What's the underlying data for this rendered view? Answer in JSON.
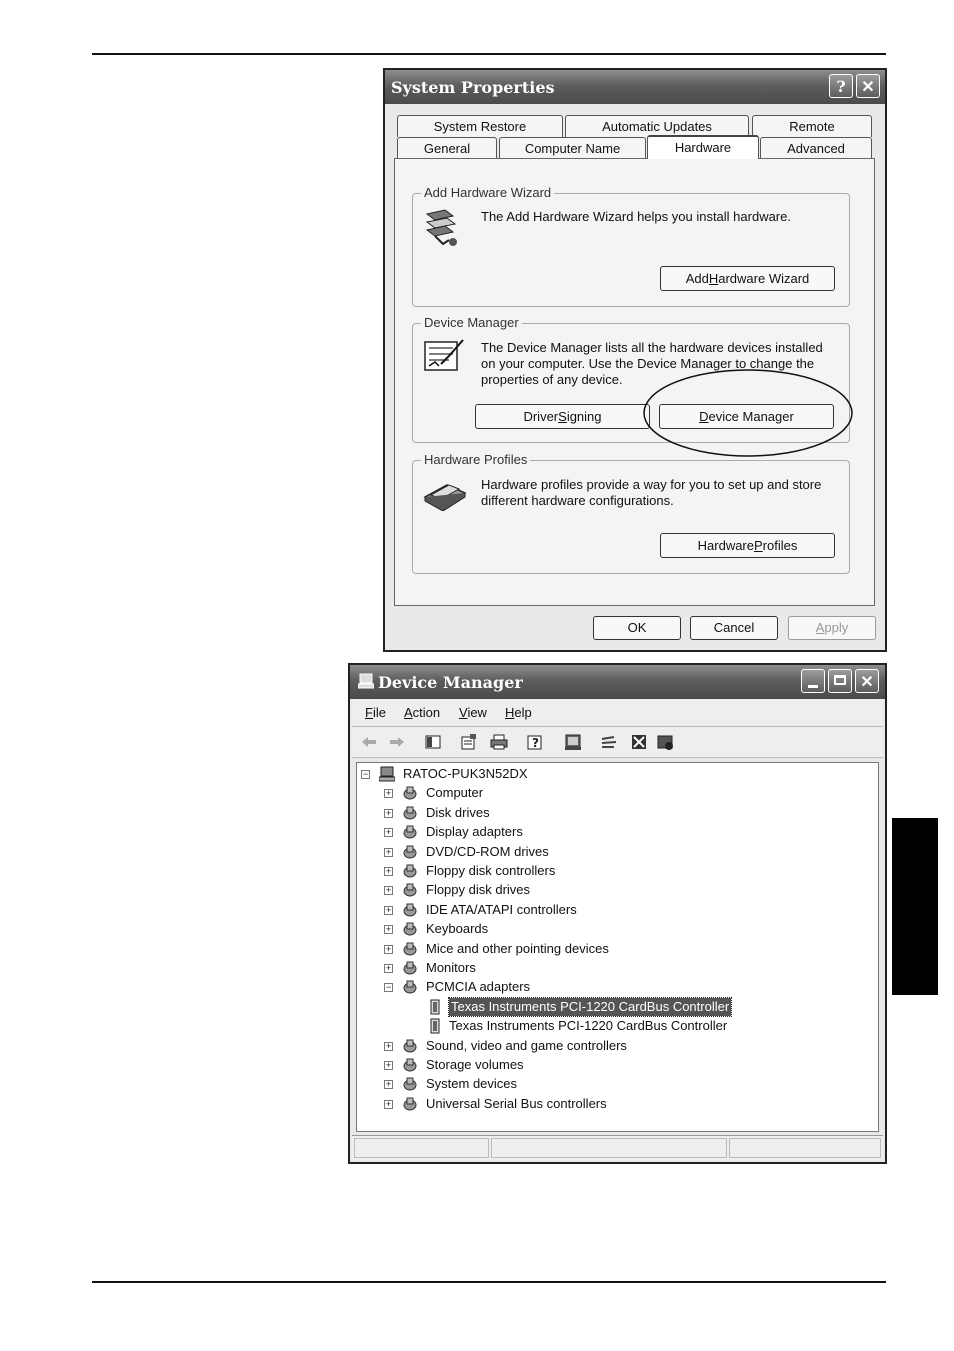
{
  "system_properties": {
    "title": "System Properties",
    "help_button": "?",
    "close_button": "✕",
    "tabs_row1": [
      "System Restore",
      "Automatic Updates",
      "Remote"
    ],
    "tabs_row2": [
      "General",
      "Computer Name",
      "Hardware",
      "Advanced"
    ],
    "active_tab": "Hardware",
    "add_hardware": {
      "title": "Add Hardware Wizard",
      "text": "The Add Hardware Wizard helps you install hardware.",
      "button_pre": "Add ",
      "button_key": "H",
      "button_post": "ardware Wizard",
      "icon": "hardware-wizard-icon"
    },
    "device_manager": {
      "title": "Device Manager",
      "text": "The Device Manager lists all the hardware devices installed on your computer. Use the Device Manager to change the properties of any device.",
      "driver_pre": "Driver ",
      "driver_key": "S",
      "driver_post": "igning",
      "dm_pre": "",
      "dm_key": "D",
      "dm_post": "evice Manager",
      "icon": "device-manager-icon"
    },
    "hardware_profiles": {
      "title": "Hardware Profiles",
      "text": "Hardware profiles provide a way for you to set up and store different hardware configurations.",
      "button_pre": "Hardware ",
      "button_key": "P",
      "button_post": "rofiles",
      "icon": "hardware-profiles-icon"
    },
    "ok": "OK",
    "cancel": "Cancel",
    "apply_key": "A",
    "apply_post": "pply"
  },
  "device_manager_window": {
    "title": "Device Manager",
    "menu": [
      {
        "key": "F",
        "rest": "ile"
      },
      {
        "key": "A",
        "rest": "ction"
      },
      {
        "key": "V",
        "rest": "iew"
      },
      {
        "key": "H",
        "rest": "elp"
      }
    ],
    "toolbar_icons": [
      "back-icon",
      "forward-icon",
      "console-tree-icon",
      "properties-icon",
      "print-icon",
      "help-icon",
      "scan-hardware-icon",
      "update-driver-icon",
      "uninstall-icon",
      "disable-icon"
    ],
    "root": "RATOC-PUK3N52DX",
    "categories": [
      "Computer",
      "Disk drives",
      "Display adapters",
      "DVD/CD-ROM drives",
      "Floppy disk controllers",
      "Floppy disk drives",
      "IDE ATA/ATAPI controllers",
      "Keyboards",
      "Mice and other pointing devices",
      "Monitors",
      "PCMCIA adapters",
      "Sound, video and game controllers",
      "Storage volumes",
      "System devices",
      "Universal Serial Bus controllers"
    ],
    "expanded_category": "PCMCIA adapters",
    "pcmcia_children": [
      "Texas Instruments PCI-1220 CardBus Controller",
      "Texas Instruments PCI-1220 CardBus Controller"
    ],
    "selected_child_index": 0
  },
  "colors": {
    "titlebar": "#5e5e5e",
    "selection": "#555555",
    "side_tab": "#000000"
  }
}
